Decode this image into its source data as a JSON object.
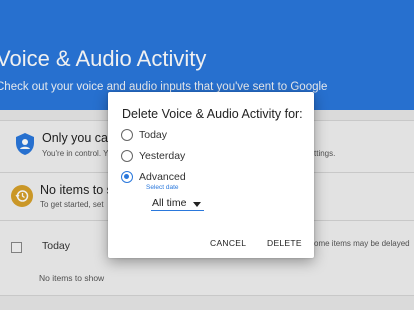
{
  "header": {
    "title": "Voice & Audio Activity",
    "subtitle": "Check out your voice and audio inputs that you've sent to Google"
  },
  "control_card": {
    "title": "Only you can s",
    "subtitle_left": "You're in control. Y",
    "subtitle_right": "ttings."
  },
  "empty_card": {
    "title": "No items to sh",
    "subtitle": "To get started, set"
  },
  "today_card": {
    "label": "Today",
    "note": "ome items may be delayed",
    "empty_text": "No items to show"
  },
  "dialog": {
    "title": "Delete Voice & Audio Activity for:",
    "options": [
      {
        "label": "Today",
        "selected": false
      },
      {
        "label": "Yesterday",
        "selected": false
      },
      {
        "label": "Advanced",
        "selected": true
      }
    ],
    "select_hint": "Select date",
    "select_value": "All time",
    "cancel": "CANCEL",
    "delete": "DELETE"
  },
  "colors": {
    "header_blue": "#2a78dc",
    "shield_blue": "#2a78dc",
    "clock_amber": "#d7a12a"
  }
}
